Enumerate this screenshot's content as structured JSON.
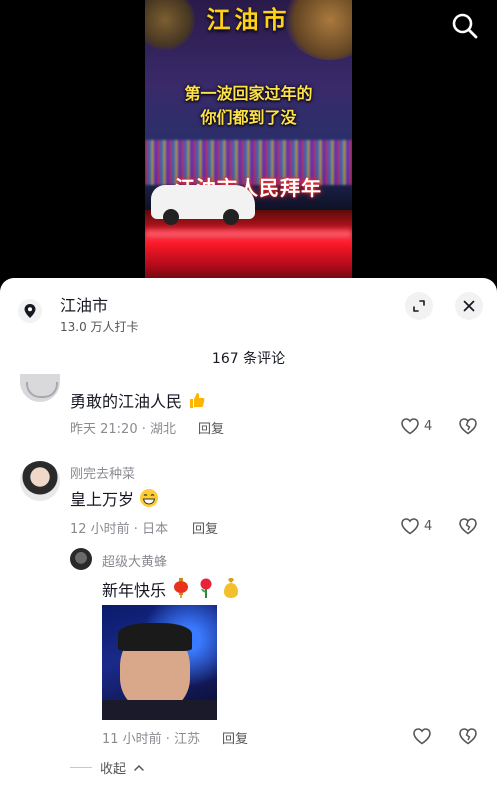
{
  "video": {
    "title": "江油市",
    "subtitle_line1": "第一波回家过年的",
    "subtitle_line2": "你们都到了没",
    "sign_text": "江油市人民拜年"
  },
  "top_bar": {
    "search_icon": "search-icon"
  },
  "location": {
    "name": "江油市",
    "checkins": "13.0 万人打卡",
    "icon": "location-pin-icon"
  },
  "comments_header": {
    "count_label": "167 条评论"
  },
  "comments": [
    {
      "name": "",
      "text": "勇敢的江油人民",
      "emoji": "thumbs-up-emoji",
      "meta": "昨天 21:20 · 湖北",
      "reply_label": "回复",
      "likes": "4"
    },
    {
      "name": "刚完去种菜",
      "text": "皇上万岁",
      "emoji": "grin-emoji",
      "meta": "12 小时前 · 日本",
      "reply_label": "回复",
      "likes": "4",
      "replies": [
        {
          "name": "超级大黄蜂",
          "text": "新年快乐",
          "emojis": [
            "lantern-emoji",
            "rose-emoji",
            "money-bag-emoji"
          ],
          "meta": "11 小时前 · 江苏",
          "reply_label": "回复",
          "likes": ""
        }
      ]
    }
  ],
  "collapse_label": "收起",
  "colors": {
    "accent": "#161823",
    "muted": "#8a8b91",
    "video_title": "#ffd21a"
  }
}
